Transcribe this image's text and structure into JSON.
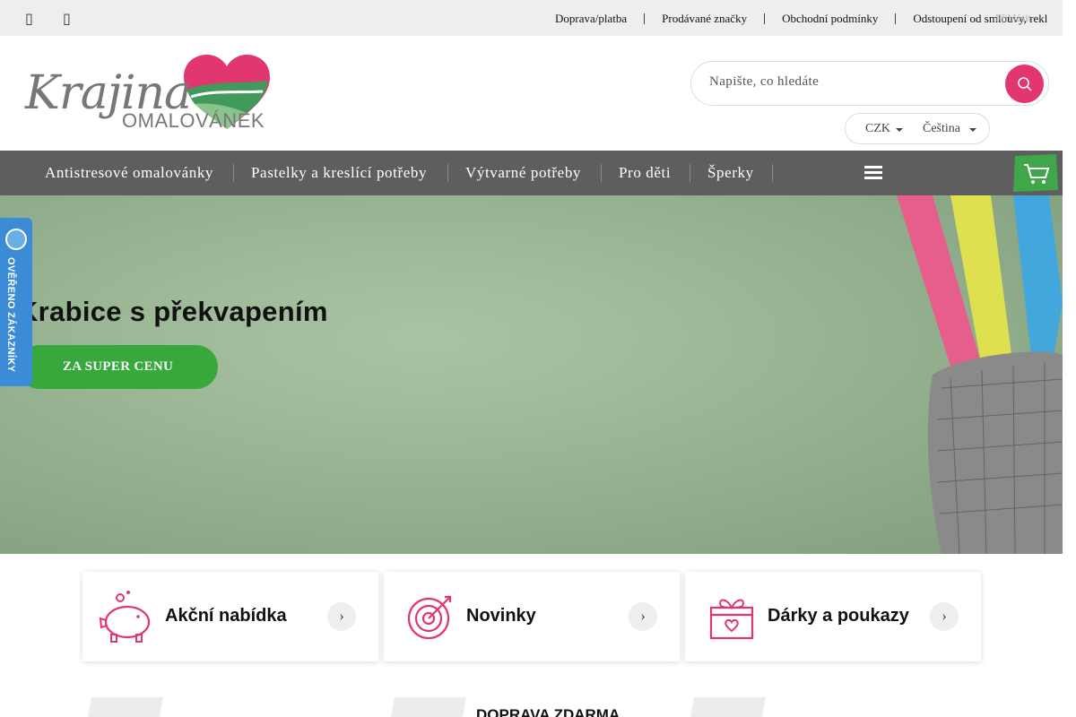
{
  "topbar": {
    "icon_left": "☰",
    "icon_right": "☆",
    "links": [
      "Doprava/platba",
      "Prodávané značky",
      "Obchodní podmínky",
      "Odstoupení od smlouvy, rekl"
    ],
    "login_overlay": "Přihlásit"
  },
  "logo": {
    "word": "Krajina",
    "sub": "OMALOVÁNEK"
  },
  "search": {
    "placeholder": "Napište, co hledáte"
  },
  "locale": {
    "currency": "CZK",
    "language": "Čeština"
  },
  "nav": {
    "items": [
      "Antistresové omalovánky",
      "Pastelky a kreslící potřeby",
      "Výtvarné potřeby",
      "Pro děti",
      "Šperky"
    ]
  },
  "hero": {
    "title": "Krabice s překvapením",
    "button": "ZA SUPER CENU"
  },
  "badge": {
    "text": "OVĚŘENO ZÁKAZNÍKY"
  },
  "cards": [
    {
      "label": "Akční nabídka",
      "icon": "piggy-bank-icon"
    },
    {
      "label": "Novinky",
      "icon": "target-icon"
    },
    {
      "label": "Dárky a poukazy",
      "icon": "gift-icon"
    }
  ],
  "strip": {
    "shipping": "DOPRAVA ZDARMA"
  },
  "colors": {
    "brand_pink": "#e2376e",
    "nav_bg": "#5e5e5e",
    "hero_button": "#36a83c",
    "badge_blue": "#3c8bd6"
  }
}
